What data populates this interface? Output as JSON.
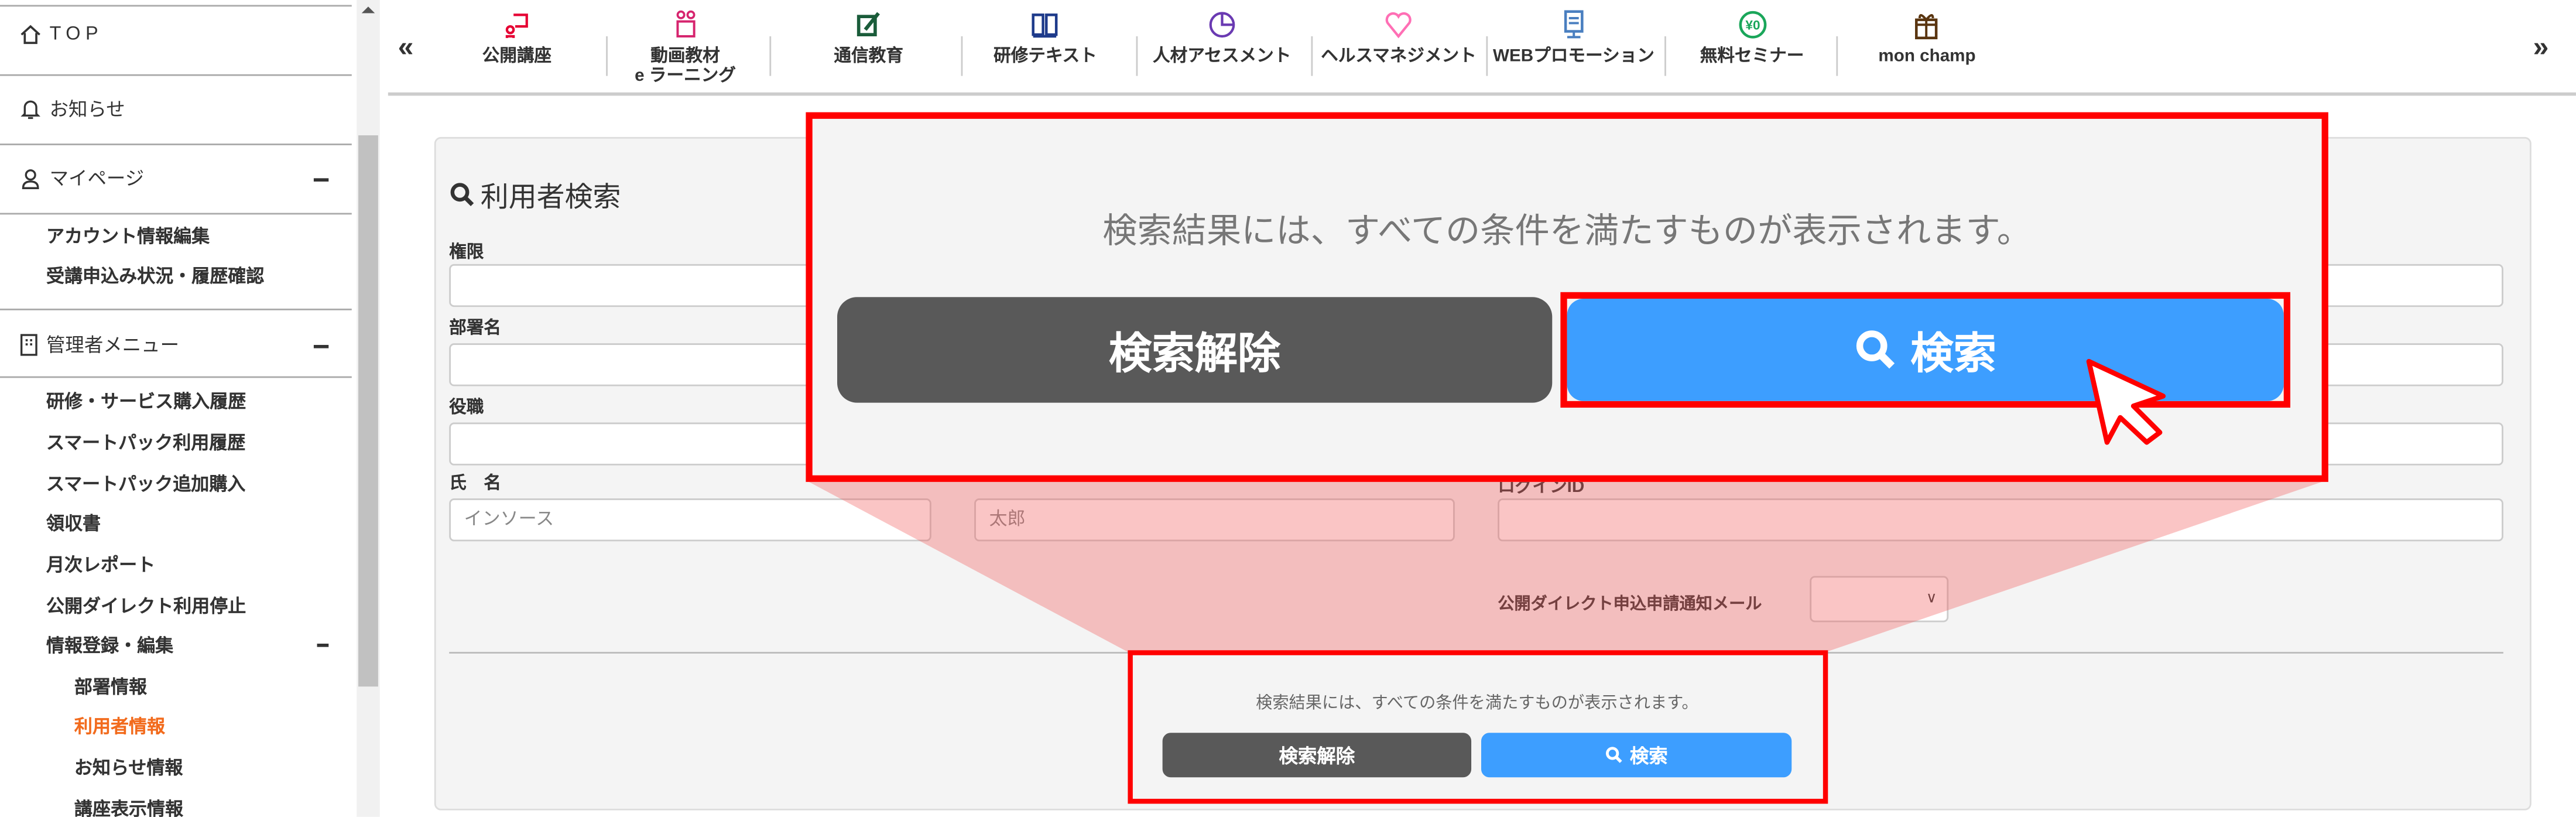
{
  "sidebar": {
    "top": "TOP",
    "news": "お知らせ",
    "mypage": "マイページ",
    "mypage_items": [
      "アカウント情報編集",
      "受講申込み状況・履歴確認"
    ],
    "admin": "管理者メニュー",
    "admin_items": [
      "研修・サービス購入履歴",
      "スマートパック利用履歴",
      "スマートパック追加購入",
      "領収書",
      "月次レポート",
      "公開ダイレクト利用停止",
      "情報登録・編集"
    ],
    "info_items": [
      "部署情報",
      "利用者情報",
      "お知らせ情報",
      "講座表示情報"
    ],
    "active_color": "#f26b1d"
  },
  "nav": {
    "prev": "«",
    "next": "»",
    "items": [
      {
        "label": "公開講座",
        "icon": "person-board-icon",
        "color": "#e60033"
      },
      {
        "label": "動画教材",
        "label2": "e ラーニング",
        "icon": "video-people-icon",
        "color": "#d6246e"
      },
      {
        "label": "通信教育",
        "icon": "pencil-note-icon",
        "color": "#1a5c3a"
      },
      {
        "label": "研修テキスト",
        "icon": "book-icon",
        "color": "#1d3a8a"
      },
      {
        "label": "人材アセスメント",
        "icon": "pie-chart-icon",
        "color": "#6a3ab2"
      },
      {
        "label": "ヘルスマネジメント",
        "icon": "heart-icon",
        "color": "#ff6fb5"
      },
      {
        "label": "WEBプロモーション",
        "icon": "monitor-icon",
        "color": "#4a7fc0"
      },
      {
        "label": "無料セミナー",
        "icon": "zero-yen-icon",
        "color": "#1aa65a"
      },
      {
        "label": "mon champ",
        "icon": "gift-icon",
        "color": "#5a3510"
      }
    ]
  },
  "search": {
    "title": "利用者検索",
    "fields": {
      "role": "権限",
      "department": "部署名",
      "position": "役職",
      "name": "氏　名",
      "last_name_placeholder": "インソース",
      "first_name_placeholder": "太郎",
      "login_id": "ログインID",
      "notify_mail": "公開ダイレクト申込申請通知メール",
      "notify_mail_value": ""
    },
    "note": "検索結果には、すべての条件を満たすものが表示されます。",
    "clear_label": "検索解除",
    "search_label": "検索"
  },
  "colors": {
    "highlight": "#ff0000",
    "search_button": "#3d9eff",
    "clear_button": "#595959"
  }
}
